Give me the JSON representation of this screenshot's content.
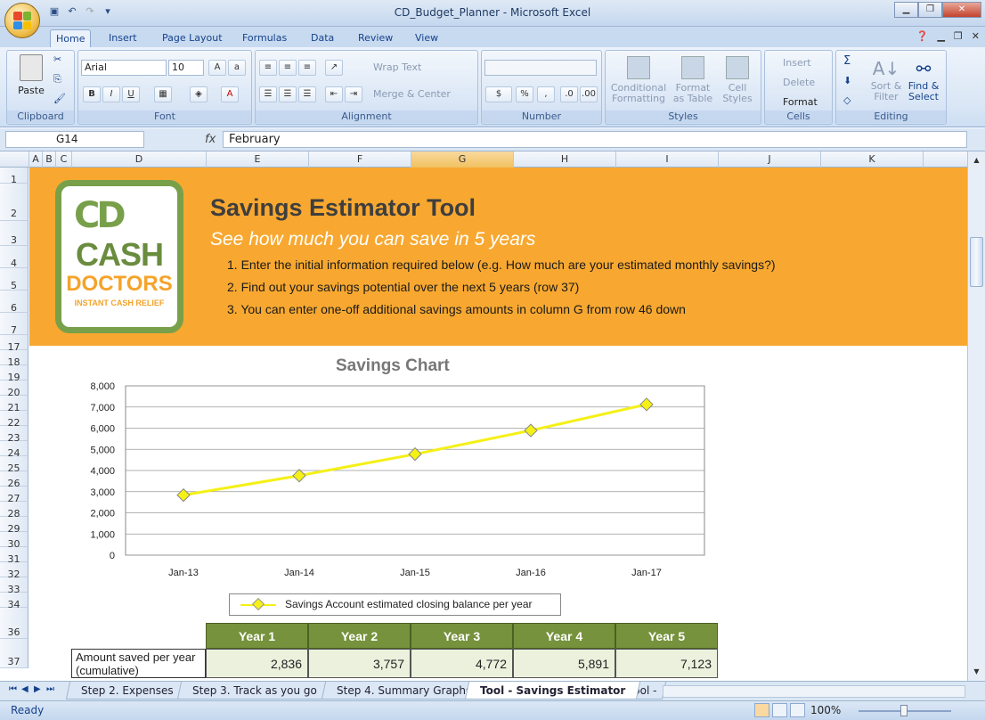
{
  "window": {
    "title": "CD_Budget_Planner - Microsoft Excel"
  },
  "ribbon_tabs": [
    "Home",
    "Insert",
    "Page Layout",
    "Formulas",
    "Data",
    "Review",
    "View"
  ],
  "ribbon": {
    "clipboard": {
      "label": "Clipboard",
      "paste": "Paste"
    },
    "font": {
      "label": "Font",
      "name": "Arial",
      "size": "10"
    },
    "alignment": {
      "label": "Alignment",
      "wrap": "Wrap Text",
      "merge": "Merge & Center"
    },
    "number": {
      "label": "Number",
      "format": "",
      "currency": "$",
      "percent": "%",
      "comma": ","
    },
    "styles": {
      "label": "Styles",
      "conditional": "Conditional Formatting",
      "format_table": "Format as Table",
      "cell_styles": "Cell Styles"
    },
    "cells": {
      "label": "Cells",
      "insert": "Insert",
      "delete": "Delete",
      "format": "Format"
    },
    "editing": {
      "label": "Editing",
      "sort": "Sort & Filter",
      "find": "Find & Select"
    }
  },
  "formula_bar": {
    "name_box": "G14",
    "fx": "fx",
    "value": "February"
  },
  "columns": [
    "A",
    "B",
    "C",
    "D",
    "E",
    "F",
    "G",
    "H",
    "I",
    "J",
    "K"
  ],
  "rows": [
    "1",
    "2",
    "3",
    "4",
    "5",
    "6",
    "7",
    "17",
    "18",
    "19",
    "20",
    "21",
    "22",
    "23",
    "24",
    "25",
    "26",
    "27",
    "28",
    "29",
    "30",
    "31",
    "32",
    "33",
    "34",
    "36",
    "37"
  ],
  "banner": {
    "logo": {
      "cd": "CD",
      "cash": "CASH",
      "doctors": "DOCTORS",
      "tagline": "INSTANT CASH RELIEF"
    },
    "title": "Savings Estimator Tool",
    "subtitle": "See how much you can save in 5 years",
    "instructions": [
      "1.  Enter the initial information required below (e.g. How much are your estimated monthly savings?)",
      "2.  Find out your savings potential over the next 5 years (row 37)",
      "3.  You can enter one-off additional savings amounts in column G from row 46 down"
    ]
  },
  "chart_data": {
    "type": "line",
    "title": "Savings Chart",
    "categories": [
      "Jan-13",
      "Jan-14",
      "Jan-15",
      "Jan-16",
      "Jan-17"
    ],
    "series": [
      {
        "name": "Savings Account estimated closing balance per year",
        "values": [
          2836,
          3757,
          4772,
          5891,
          7123
        ],
        "color": "#f5f016"
      }
    ],
    "ylim": [
      0,
      8000
    ],
    "yticks": [
      "8,000",
      "7,000",
      "6,000",
      "5,000",
      "4,000",
      "3,000",
      "2,000",
      "1,000",
      "0"
    ],
    "grid": true,
    "legend": "bottom"
  },
  "summary_table": {
    "headers": [
      "Year 1",
      "Year 2",
      "Year 3",
      "Year 4",
      "Year 5"
    ],
    "row_label": "Amount saved per year (cumulative)",
    "values": [
      "2,836",
      "3,757",
      "4,772",
      "5,891",
      "7,123"
    ]
  },
  "sheet_tabs": [
    "Step 2. Expenses",
    "Step 3. Track as you go",
    "Step 4. Summary Graphs",
    "Tool - Savings Estimator",
    "Tool -"
  ],
  "active_sheet": "Tool - Savings Estimator",
  "status": {
    "ready": "Ready",
    "zoom": "100%"
  },
  "colors": {
    "banner": "#f8a830",
    "header_green": "#76923c",
    "cell_green": "#ebf1dd",
    "logo_green": "#78a04a"
  }
}
